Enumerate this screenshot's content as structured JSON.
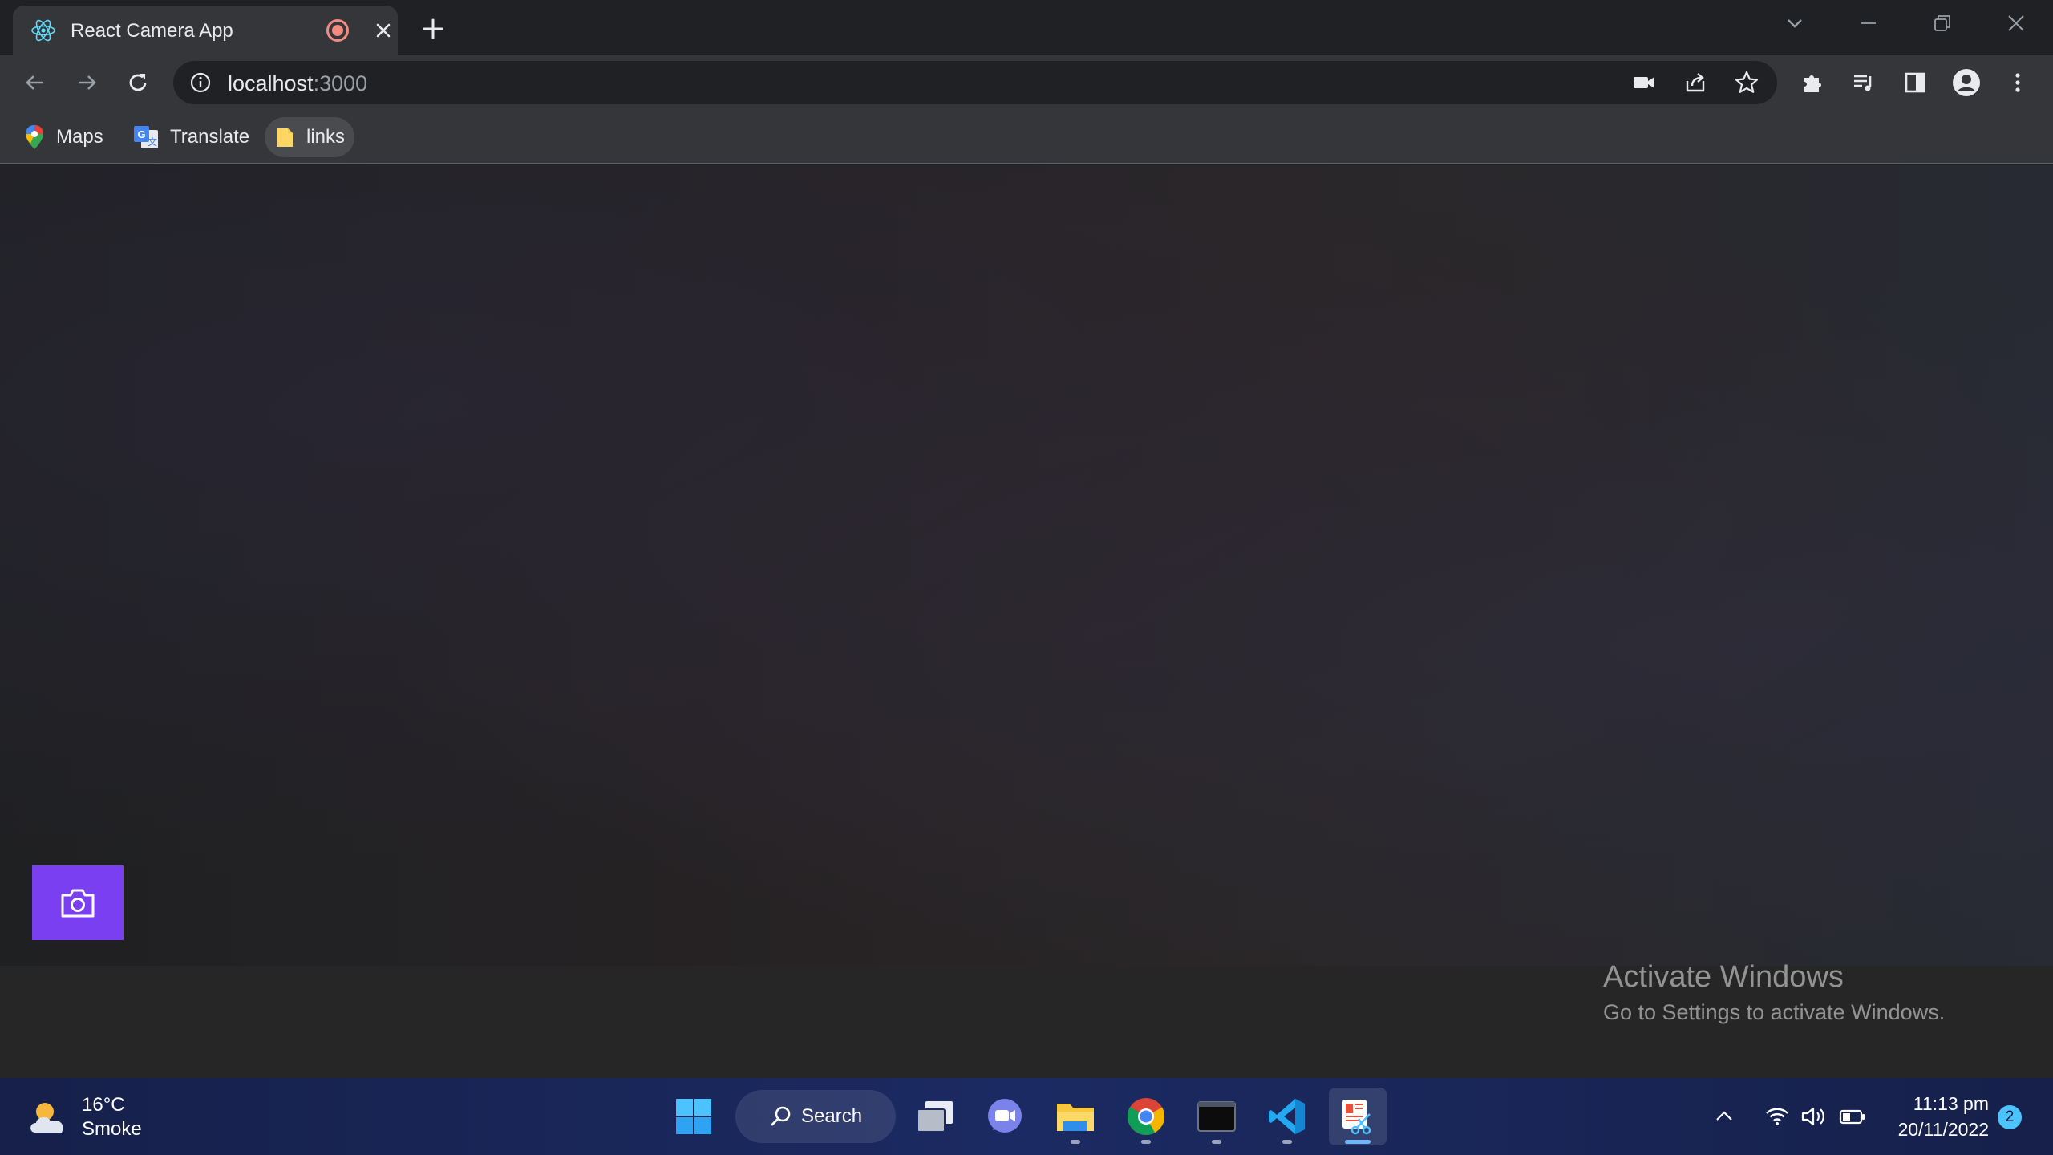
{
  "browser": {
    "tab": {
      "title": "React Camera App",
      "favicon": "react-atom-icon",
      "recording_indicator": "recording-dot-icon"
    },
    "address_bar": {
      "host": "localhost",
      "port": ":3000"
    },
    "bookmarks": [
      {
        "label": "Maps",
        "icon": "maps-pin-icon"
      },
      {
        "label": "Translate",
        "icon": "translate-icon"
      },
      {
        "label": "links",
        "icon": "folder-icon"
      }
    ]
  },
  "page": {
    "capture_button_icon": "camera-icon",
    "accent_color": "#7b3ff2"
  },
  "watermark": {
    "title": "Activate Windows",
    "subtitle": "Go to Settings to activate Windows."
  },
  "taskbar": {
    "weather": {
      "temp": "16°C",
      "desc": "Smoke"
    },
    "search_label": "Search",
    "apps": [
      "windows-start-icon",
      "task-view-icon",
      "teams-chat-icon",
      "file-explorer-icon",
      "chrome-icon",
      "terminal-icon",
      "vscode-icon",
      "snipping-tool-icon"
    ],
    "clock": {
      "time": "11:13 pm",
      "date": "20/11/2022"
    },
    "notification_count": "2"
  }
}
